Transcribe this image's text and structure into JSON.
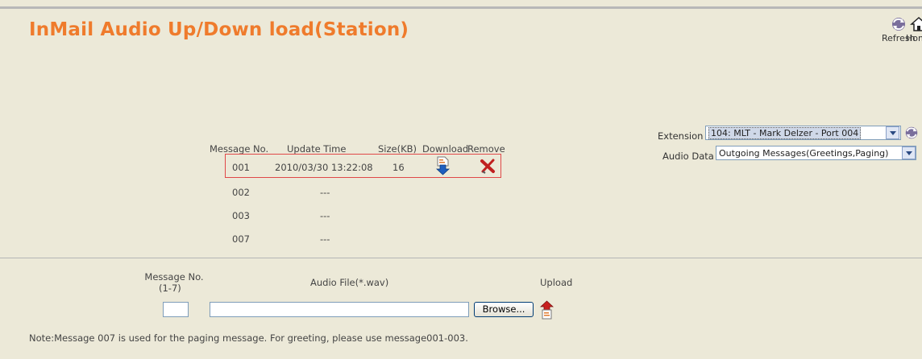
{
  "page": {
    "title": "InMail Audio Up/Down load(Station)"
  },
  "toolbar": {
    "refresh_label": "Refresh",
    "home_label": "Home"
  },
  "filters": {
    "extension_label": "Extension",
    "extension_value": "104: MLT - Mark Delzer - Port 004",
    "audio_data_label": "Audio Data",
    "audio_data_value": "Outgoing Messages(Greetings,Paging)"
  },
  "table": {
    "headers": [
      "Message No.",
      "Update Time",
      "Size(KB)",
      "Download",
      "Remove"
    ],
    "rows": [
      {
        "no": "001",
        "time": "2010/03/30 13:22:08",
        "size": "16",
        "downloadable": true
      },
      {
        "no": "002",
        "time": "---",
        "size": "",
        "downloadable": false
      },
      {
        "no": "003",
        "time": "---",
        "size": "",
        "downloadable": false
      },
      {
        "no": "007",
        "time": "---",
        "size": "",
        "downloadable": false
      }
    ]
  },
  "upload": {
    "message_no_label": "Message No.",
    "message_no_range": "(1-7)",
    "audio_file_label": "Audio File(*.wav)",
    "upload_label": "Upload",
    "browse_label": "Browse...",
    "message_no_value": "",
    "audio_file_value": ""
  },
  "note": "Note:Message 007 is used for the paging message. For greeting, please use message001-003.",
  "colors": {
    "title": "#ef7b2c",
    "background": "#ece9d8",
    "highlight_border": "#e04848"
  }
}
